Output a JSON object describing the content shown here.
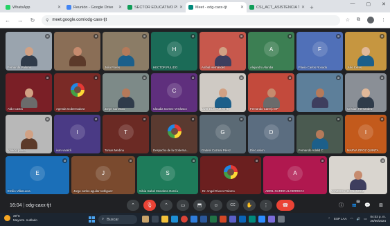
{
  "browser": {
    "tabs": [
      {
        "title": "WhatsApp",
        "color": "#25d366",
        "active": false
      },
      {
        "title": "Reunión - Google Drive",
        "color": "#4285f4",
        "active": false
      },
      {
        "title": "SECTOR EDUCATIVO PROPUES",
        "color": "#0f9d58",
        "active": false
      },
      {
        "title": "Meet - odg-caxx-tjt",
        "color": "#00897b",
        "active": true
      },
      {
        "title": "CSI_ACT_ASISTENCIA TÉCNIC",
        "color": "#0f9d58",
        "active": false
      }
    ],
    "new_tab": "+",
    "url": "meet.google.com/odg-caxx-tjt"
  },
  "meeting": {
    "time": "16:04",
    "code": "odg-caxx-tjt",
    "participant_badge": "38"
  },
  "participants": [
    {
      "name": "Fernanda Palomo",
      "type": "video",
      "bg": "#9aa4ae"
    },
    {
      "name": "",
      "type": "video",
      "bg": "#8a6e56"
    },
    {
      "name": "Julio Flores",
      "type": "video",
      "bg": "#8b7c66"
    },
    {
      "name": "HECTOR PULIDO",
      "type": "initial",
      "letter": "H",
      "bg": "#1b6b57"
    },
    {
      "name": "Aníbal Hernández",
      "type": "video",
      "bg": "#c7584c"
    },
    {
      "name": "Alejandro Alandia",
      "type": "initial",
      "letter": "A",
      "bg": "#3c7f53"
    },
    {
      "name": "Flavio Carlos Rosado",
      "type": "initial",
      "letter": "F",
      "bg": "#5070b8"
    },
    {
      "name": "Julio torres",
      "type": "video",
      "bg": "#c69640"
    },
    {
      "name": "Aldo Castro",
      "type": "video",
      "bg": "#7a1f26"
    },
    {
      "name": "Agenda Gobernadora",
      "type": "logo",
      "bg": "#7a2a26"
    },
    {
      "name": "Jorge Carrasco",
      "type": "video",
      "bg": "#7d8a88"
    },
    {
      "name": "Claudia Gomez Verdusco",
      "type": "initial",
      "letter": "C",
      "bg": "#5f2f7d"
    },
    {
      "name": "LUIS BUSTAMANTE",
      "type": "video",
      "bg": "#cfcac4"
    },
    {
      "name": "Fernando Carrejo SP",
      "type": "video",
      "bg": "#c34a3c"
    },
    {
      "name": "",
      "type": "video",
      "bg": "#5d7f9a"
    },
    {
      "name": "Cristian Hernandez",
      "type": "video",
      "bg": "#8a8f96"
    },
    {
      "name": "Ignacio perera",
      "type": "video",
      "bg": "#b8b8b8"
    },
    {
      "name": "ivan varaldi",
      "type": "initial",
      "letter": "I",
      "bg": "#4a3a85"
    },
    {
      "name": "Tomas Medina",
      "type": "initial",
      "letter": "T",
      "bg": "#6b2a24"
    },
    {
      "name": "Despacho de la Goberna...",
      "type": "logo",
      "bg": "#5a3a30"
    },
    {
      "name": "Gabriel Cazmal Pérez",
      "type": "initial",
      "letter": "G",
      "bg": "#5b6a75"
    },
    {
      "name": "Discussion",
      "type": "initial",
      "letter": "D",
      "bg": "#5b6d80"
    },
    {
      "name": "Fernando Adalid C",
      "type": "video",
      "bg": "#4a5a50"
    },
    {
      "name": "MARVA OROZ QUINTA...",
      "type": "initial",
      "letter": "I",
      "bg": "#c35a1c"
    },
    {
      "name": "Emilio Villanueva",
      "type": "initial",
      "letter": "E",
      "bg": "#1b6fb8"
    },
    {
      "name": "Jorge carlos aguilar rodriguez",
      "type": "initial",
      "letter": "J",
      "bg": "#7a4a2e"
    },
    {
      "name": "Silvia Isabel Mendoza García",
      "type": "initial",
      "letter": "S",
      "bg": "#1e7b5a"
    },
    {
      "name": "Dr. Angel Rivero Palomo",
      "type": "logo",
      "bg": "#6b1f1f"
    },
    {
      "name": "ABRIL GARDO ALCERRECA",
      "type": "initial",
      "letter": "A",
      "bg": "#b0184f"
    },
    {
      "name": "VANESSA HERNANDEZ",
      "type": "video",
      "bg": "#d9d5cf"
    }
  ],
  "controls": {
    "mic": "🎙",
    "arrow": "⌃",
    "camera": "▭",
    "present": "⬒",
    "emoji": "☺",
    "captions": "CC",
    "hand": "✋",
    "more": "⋮",
    "end": "☎"
  },
  "side_controls": {
    "info": "ⓘ",
    "people": "👥",
    "chat": "💬",
    "activities": "⊞"
  },
  "taskbar": {
    "weather_temp": "29°C",
    "weather_desc": "Mayorm. nublado",
    "search_placeholder": "Buscar",
    "lang": "ESP LAA",
    "time": "04:03 p. m.",
    "date": "26/06/2024"
  }
}
